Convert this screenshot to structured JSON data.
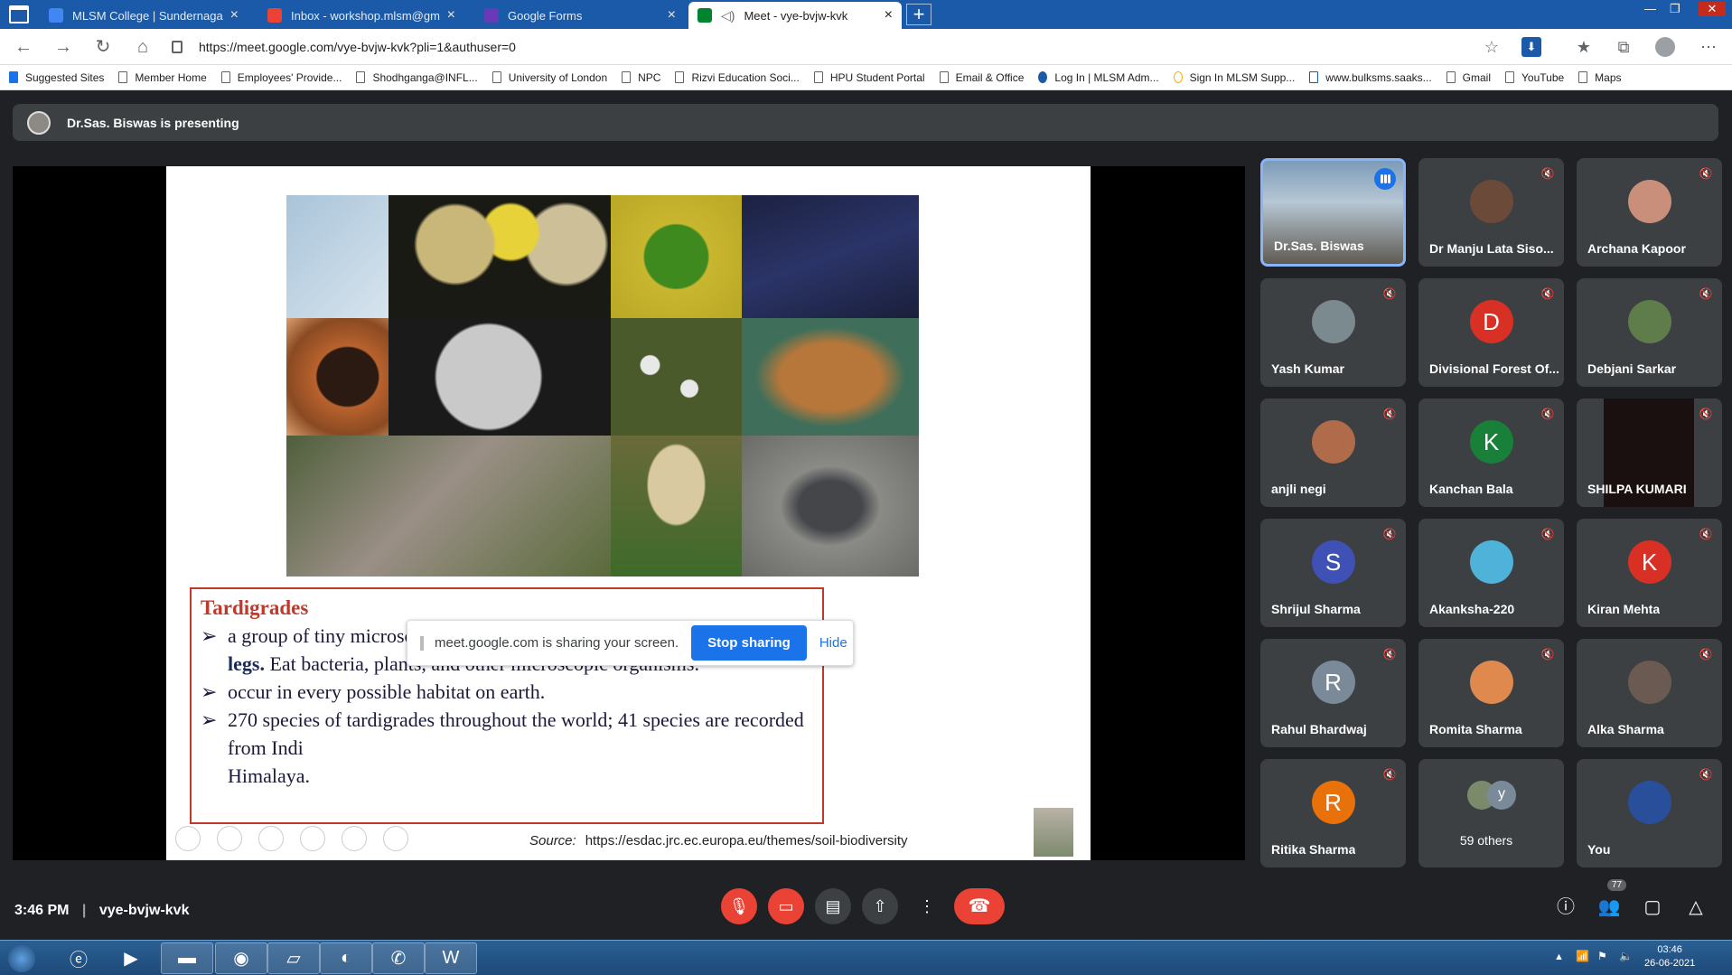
{
  "browser": {
    "tabs": [
      {
        "label": "MLSM College | Sundernagar, M",
        "fav_color": "#4285f4"
      },
      {
        "label": "Inbox - workshop.mlsm@gmail.c",
        "fav_color": "#ea4335"
      },
      {
        "label": "Google Forms",
        "fav_color": "#673ab7"
      },
      {
        "label": "Meet - vye-bvjw-kvk",
        "fav_color": "#00832d"
      }
    ],
    "url": "https://meet.google.com/vye-bvjw-kvk?pli=1&authuser=0",
    "bookmarks": [
      "Suggested Sites",
      "Member Home",
      "Employees' Provide...",
      "Shodhganga@INFL...",
      "University of London",
      "NPC",
      "Rizvi Education Soci...",
      "HPU Student Portal",
      "Email & Office",
      "Log In | MLSM Adm...",
      "Sign In MLSM Supp...",
      "www.bulksms.saaks...",
      "Gmail",
      "YouTube",
      "Maps"
    ]
  },
  "meet": {
    "presenting_text": "Dr.Sas. Biswas is presenting",
    "slide": {
      "title": "Tardigrades",
      "bullet1_a": "a group of tiny microscopic metazoan with ",
      "bullet1_b": "four pairs of lobopodial legs.",
      "bullet1_c": " Eat bacteria, plants, and other microscopic organisms.",
      "bullet2": " occur in every possible habitat on earth.",
      "bullet3": "270 species of tardigrades throughout the world; 41 species are recorded from Indi",
      "bullet3_tail": "Himalaya.",
      "source_label": "Source:",
      "source_url": "https://esdac.jrc.ec.europa.eu/themes/soil-biodiversity"
    },
    "sharebar": {
      "message": "meet.google.com is sharing your screen.",
      "stop": "Stop sharing",
      "hide": "Hide"
    },
    "participants": [
      {
        "name": "Dr.Sas. Biswas",
        "type": "video"
      },
      {
        "name": "Dr Manju Lata Siso...",
        "type": "photo",
        "color": "#6b4a3a"
      },
      {
        "name": "Archana Kapoor",
        "type": "photo",
        "color": "#c98f7b"
      },
      {
        "name": "Yash Kumar",
        "type": "photo",
        "color": "#7a8a8f"
      },
      {
        "name": "Divisional Forest Of...",
        "type": "letter",
        "letter": "D",
        "color": "#d93025"
      },
      {
        "name": "Debjani Sarkar",
        "type": "photo",
        "color": "#5f7d4b"
      },
      {
        "name": "anjli negi",
        "type": "photo",
        "color": "#b06c4a"
      },
      {
        "name": "Kanchan Bala",
        "type": "letter",
        "letter": "K",
        "color": "#188038"
      },
      {
        "name": "SHILPA KUMARI",
        "type": "video-dark"
      },
      {
        "name": "Shrijul Sharma",
        "type": "letter",
        "letter": "S",
        "color": "#3f51b5"
      },
      {
        "name": "Akanksha-220",
        "type": "photo",
        "color": "#4fb3d9"
      },
      {
        "name": "Kiran Mehta",
        "type": "letter",
        "letter": "K",
        "color": "#d93025"
      },
      {
        "name": "Rahul Bhardwaj",
        "type": "letter",
        "letter": "R",
        "color": "#7b8a99"
      },
      {
        "name": "Romita Sharma",
        "type": "photo",
        "color": "#e0894f"
      },
      {
        "name": "Alka Sharma",
        "type": "photo",
        "color": "#6b5a52"
      },
      {
        "name": "Ritika Sharma",
        "type": "letter",
        "letter": "R",
        "color": "#e8710a"
      },
      {
        "name": "59 others",
        "type": "others"
      },
      {
        "name": "You",
        "type": "photo",
        "color": "#2a4f9a"
      }
    ],
    "others_letter": "y",
    "time": "3:46 PM",
    "meeting_code": "vye-bvjw-kvk",
    "people_count": "77"
  },
  "taskbar": {
    "time": "03:46",
    "date": "26-06-2021"
  }
}
